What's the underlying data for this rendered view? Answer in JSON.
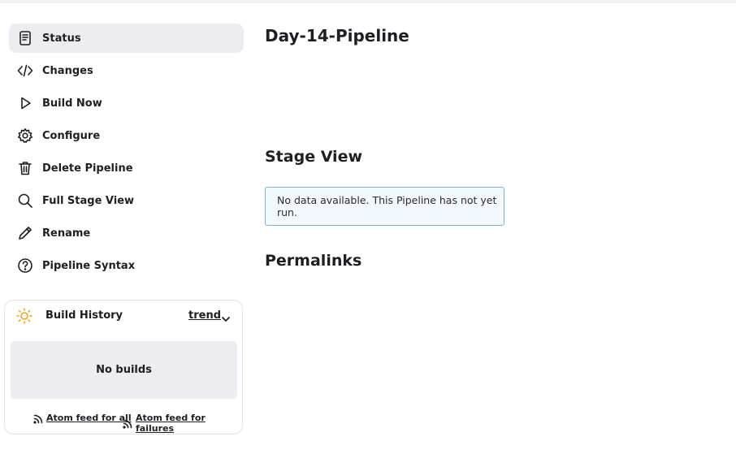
{
  "sidebar": {
    "items": [
      {
        "label": "Status",
        "icon": "document-icon",
        "active": true
      },
      {
        "label": "Changes",
        "icon": "code-icon"
      },
      {
        "label": "Build Now",
        "icon": "play-icon"
      },
      {
        "label": "Configure",
        "icon": "gear-icon"
      },
      {
        "label": "Delete Pipeline",
        "icon": "trash-icon"
      },
      {
        "label": "Full Stage View",
        "icon": "search-icon"
      },
      {
        "label": "Rename",
        "icon": "pencil-icon"
      },
      {
        "label": "Pipeline Syntax",
        "icon": "help-icon"
      }
    ]
  },
  "build_history": {
    "title": "Build History",
    "trend_label": "trend",
    "empty_text": "No builds",
    "feed_all": "Atom feed for all",
    "feed_failures": "Atom feed for failures",
    "icon": "sun-icon",
    "icon_color": "#e8a31c"
  },
  "main": {
    "title": "Day-14-Pipeline",
    "stage_view_heading": "Stage View",
    "stage_view_notice": "No data available. This Pipeline has not yet run.",
    "permalinks_heading": "Permalinks"
  },
  "colors": {
    "active_bg": "#ededf1",
    "notice_border": "#7fb2d6",
    "notice_bg": "#f2f8fc"
  }
}
